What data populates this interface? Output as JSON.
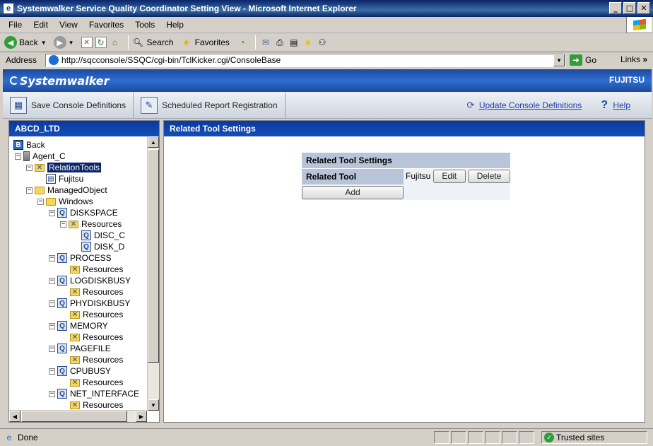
{
  "window": {
    "title": "Systemwalker Service Quality Coordinator Setting View - Microsoft Internet Explorer",
    "controls": [
      "_",
      "□",
      "✕"
    ]
  },
  "menu": [
    "File",
    "Edit",
    "View",
    "Favorites",
    "Tools",
    "Help"
  ],
  "toolbar": {
    "back": "Back",
    "search": "Search",
    "favorites": "Favorites"
  },
  "address": {
    "label": "Address",
    "url": "http://sqcconsole/SSQC/cgi-bin/TclKicker.cgi/ConsoleBase",
    "go": "Go",
    "links": "Links"
  },
  "banner": {
    "brand": "Systemwalker",
    "vendor": "FUJITSU"
  },
  "appbar": {
    "save": "Save Console Definitions",
    "scheduled": "Scheduled Report Registration",
    "update": "Update Console Definitions",
    "help": "Help"
  },
  "left_panel": {
    "title": "ABCD_LTD"
  },
  "tree": [
    {
      "label": "Back"
    },
    {
      "label": "Agent_C"
    },
    {
      "label": "RelationTools"
    },
    {
      "label": "Fujitsu"
    },
    {
      "label": "ManagedObject"
    },
    {
      "label": "Windows"
    },
    {
      "label": "DISKSPACE"
    },
    {
      "label": "Resources"
    },
    {
      "label": "DISC_C"
    },
    {
      "label": "DISK_D"
    },
    {
      "label": "PROCESS"
    },
    {
      "label": "Resources"
    },
    {
      "label": "LOGDISKBUSY"
    },
    {
      "label": "Resources"
    },
    {
      "label": "PHYDISKBUSY"
    },
    {
      "label": "Resources"
    },
    {
      "label": "MEMORY"
    },
    {
      "label": "Resources"
    },
    {
      "label": "PAGEFILE"
    },
    {
      "label": "Resources"
    },
    {
      "label": "CPUBUSY"
    },
    {
      "label": "Resources"
    },
    {
      "label": "NET_INTERFACE"
    },
    {
      "label": "Resources"
    }
  ],
  "right_panel": {
    "title": "Related Tool Settings"
  },
  "settings": {
    "caption": "Related Tool Settings",
    "label": "Related Tool",
    "value": "Fujitsu",
    "edit": "Edit",
    "delete": "Delete",
    "add": "Add"
  },
  "status": {
    "text": "Done",
    "zone": "Trusted sites"
  }
}
